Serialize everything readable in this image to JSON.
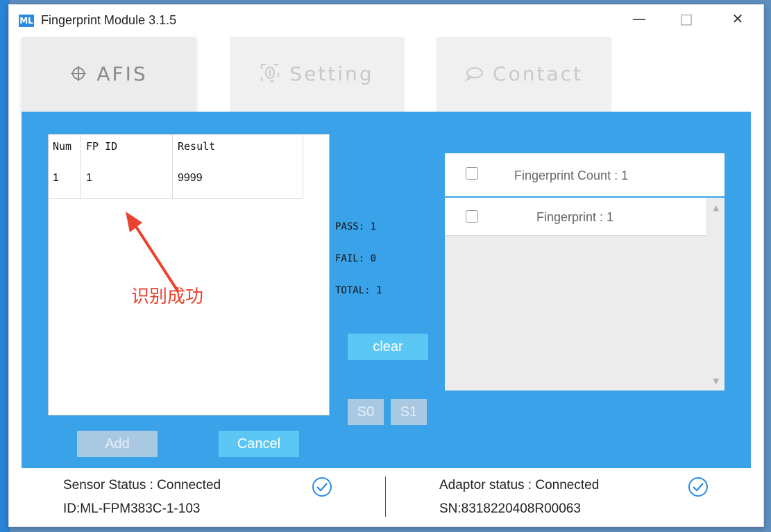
{
  "window": {
    "logo": "ML",
    "title": "Fingerprint Module 3.1.5",
    "minimize": "—",
    "maximize": "□",
    "close": "✕"
  },
  "tabs": [
    {
      "label": "AFIS",
      "icon": "crosshair-icon"
    },
    {
      "label": "Setting",
      "icon": "fingerprint-icon"
    },
    {
      "label": "Contact",
      "icon": "chat-bubble-icon"
    }
  ],
  "table": {
    "columns": [
      "Num",
      "FP ID",
      "Result"
    ],
    "rows": [
      {
        "num": "1",
        "fp_id": "1",
        "result": "9999"
      }
    ]
  },
  "annotation": "识别成功",
  "stats": {
    "pass": "PASS:  1",
    "fail": "FAIL:  0",
    "total": "TOTAL:  1"
  },
  "buttons": {
    "clear": "clear",
    "s0": "S0",
    "s1": "S1",
    "add": "Add",
    "cancel": "Cancel"
  },
  "fingerprint_list": {
    "header": "Fingerprint Count : 1",
    "items": [
      "Fingerprint : 1"
    ]
  },
  "status": {
    "sensor_status": "Sensor Status : Connected",
    "sensor_id": "ID:ML-FPM383C-1-103",
    "adaptor_status": "Adaptor status : Connected",
    "adaptor_sn": "SN:8318220408R00063"
  },
  "colors": {
    "panel_blue": "#3aa2e9",
    "button_cyan": "#5cc7f5",
    "button_disabled": "#a9c9e3",
    "annotation_red": "#e8432e",
    "check_blue": "#2c8be0"
  }
}
